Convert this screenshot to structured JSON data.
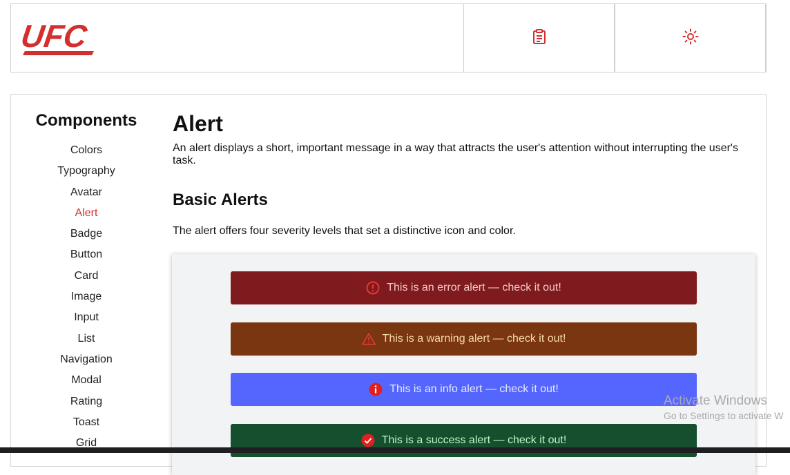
{
  "header": {
    "logo_text": "UFC",
    "buttons": [
      {
        "icon": "clipboard-icon"
      },
      {
        "icon": "sun-icon"
      }
    ]
  },
  "colors": {
    "accent": "#d32f2f",
    "error_bg": "#7f1b1e",
    "warning_bg": "#7a3511",
    "info_bg": "#5566ff",
    "success_bg": "#154f2e"
  },
  "sidebar": {
    "title": "Components",
    "items": [
      {
        "label": "Colors"
      },
      {
        "label": "Typography"
      },
      {
        "label": "Avatar"
      },
      {
        "label": "Alert"
      },
      {
        "label": "Badge"
      },
      {
        "label": "Button"
      },
      {
        "label": "Card"
      },
      {
        "label": "Image"
      },
      {
        "label": "Input"
      },
      {
        "label": "List"
      },
      {
        "label": "Navigation"
      },
      {
        "label": "Modal"
      },
      {
        "label": "Rating"
      },
      {
        "label": "Toast"
      },
      {
        "label": "Grid"
      }
    ],
    "active": "Alert"
  },
  "content": {
    "title": "Alert",
    "intro": "An alert displays a short, important message in a way that attracts the user's attention without interrupting the user's task.",
    "section_title": "Basic Alerts",
    "section_lead": "The alert offers four severity levels that set a distinctive icon and color.",
    "alerts": [
      {
        "severity": "error",
        "icon": "error-circle-icon",
        "text": "This is an error alert — check it out!"
      },
      {
        "severity": "warning",
        "icon": "warning-triangle-icon",
        "text": "This is a warning alert — check it out!"
      },
      {
        "severity": "info",
        "icon": "info-circle-icon",
        "text": "This is an info alert — check it out!"
      },
      {
        "severity": "success",
        "icon": "check-circle-icon",
        "text": "This is a success alert — check it out!"
      }
    ]
  },
  "watermark": {
    "line1": "Activate Windows",
    "line2": "Go to Settings to activate W"
  }
}
